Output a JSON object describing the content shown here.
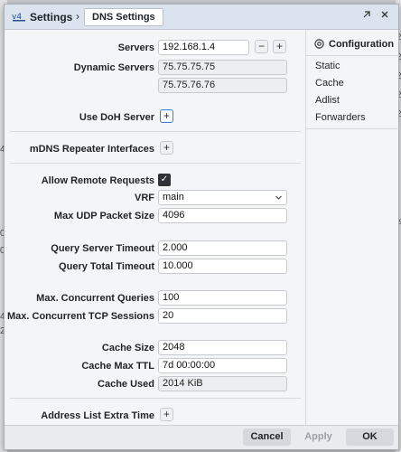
{
  "titlebar": {
    "app_title": "Settings",
    "separator": "›",
    "tab_label": "DNS Settings",
    "restore_icon": "restore-icon",
    "close_icon": "close-icon"
  },
  "form": {
    "servers": {
      "label": "Servers",
      "value": "192.168.1.4",
      "remove": "−",
      "add": "+"
    },
    "dynamic_servers": {
      "label": "Dynamic Servers",
      "values": [
        "75.75.75.75",
        "75.75.76.76"
      ]
    },
    "use_doh_server": {
      "label": "Use DoH Server",
      "add": "+"
    },
    "mdns_repeater": {
      "label": "mDNS Repeater Interfaces",
      "add": "+"
    },
    "allow_remote_requests": {
      "label": "Allow Remote Requests",
      "checked": true,
      "check": "✓"
    },
    "vrf": {
      "label": "VRF",
      "value": "main"
    },
    "max_udp_packet_size": {
      "label": "Max UDP Packet Size",
      "value": "4096"
    },
    "query_server_timeout": {
      "label": "Query Server Timeout",
      "value": "2.000"
    },
    "query_total_timeout": {
      "label": "Query Total Timeout",
      "value": "10.000"
    },
    "max_concurrent_queries": {
      "label": "Max. Concurrent Queries",
      "value": "100"
    },
    "max_concurrent_tcp": {
      "label": "Max. Concurrent TCP Sessions",
      "value": "20"
    },
    "cache_size": {
      "label": "Cache Size",
      "value": "2048"
    },
    "cache_max_ttl": {
      "label": "Cache Max TTL",
      "value": "7d 00:00:00"
    },
    "cache_used": {
      "label": "Cache Used",
      "value": "2014 KiB"
    },
    "address_list_extra_time": {
      "label": "Address List Extra Time",
      "add": "+"
    }
  },
  "sidebar": {
    "heading": "Configuration",
    "items": [
      "Static",
      "Cache",
      "Adlist",
      "Forwarders"
    ]
  },
  "footer": {
    "cancel": "Cancel",
    "apply": "Apply",
    "ok": "OK"
  },
  "background": {
    "fragments": [
      "22",
      "22",
      "22",
      "22",
      "22",
      "4",
      "0",
      "0",
      "4",
      "2",
      "ks"
    ]
  }
}
